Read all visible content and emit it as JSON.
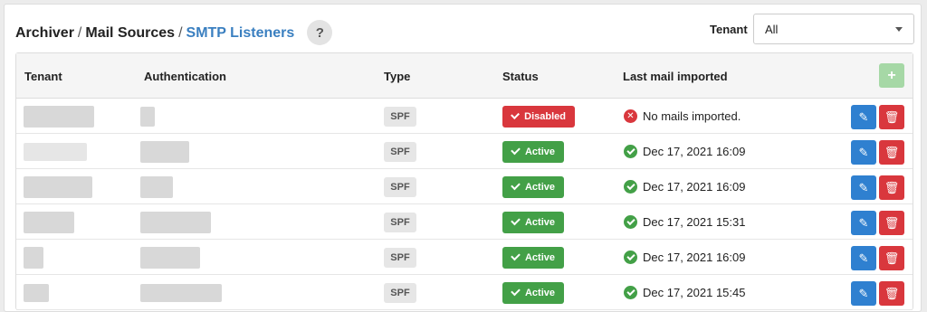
{
  "breadcrumb": {
    "part1": "Archiver",
    "sep": "/",
    "part2": "Mail Sources",
    "current": "SMTP Listeners",
    "help": "?"
  },
  "filter": {
    "label": "Tenant",
    "value": "All"
  },
  "table": {
    "columns": [
      "Tenant",
      "Authentication",
      "Type",
      "Status",
      "Last mail imported"
    ],
    "add_label": "+",
    "rows": [
      {
        "type": "SPF",
        "status": "Disabled",
        "status_kind": "disabled",
        "last": "No mails imported.",
        "last_kind": "error"
      },
      {
        "type": "SPF",
        "status": "Active",
        "status_kind": "active",
        "last": "Dec 17, 2021 16:09",
        "last_kind": "ok"
      },
      {
        "type": "SPF",
        "status": "Active",
        "status_kind": "active",
        "last": "Dec 17, 2021 16:09",
        "last_kind": "ok"
      },
      {
        "type": "SPF",
        "status": "Active",
        "status_kind": "active",
        "last": "Dec 17, 2021 15:31",
        "last_kind": "ok"
      },
      {
        "type": "SPF",
        "status": "Active",
        "status_kind": "active",
        "last": "Dec 17, 2021 16:09",
        "last_kind": "ok"
      },
      {
        "type": "SPF",
        "status": "Active",
        "status_kind": "active",
        "last": "Dec 17, 2021 15:45",
        "last_kind": "ok"
      }
    ]
  },
  "colors": {
    "active": "#43a047",
    "disabled": "#d9373d",
    "edit": "#2f80d0",
    "link": "#3a7fc0"
  }
}
